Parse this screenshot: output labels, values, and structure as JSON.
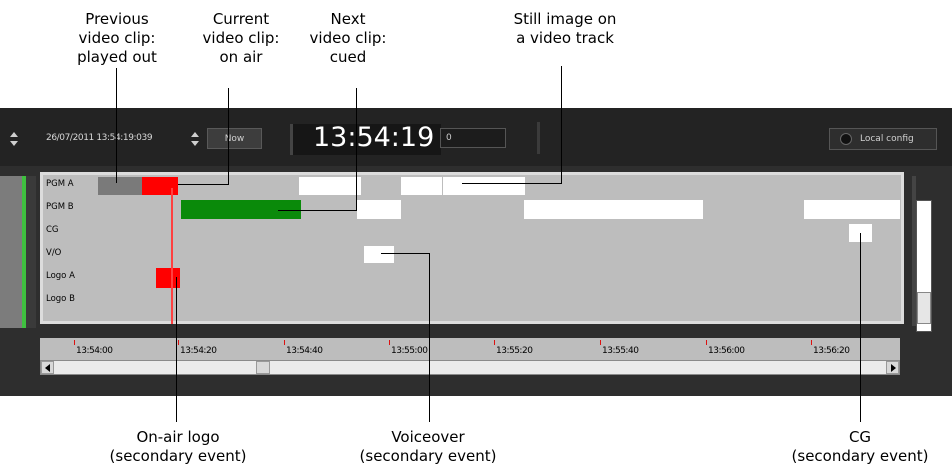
{
  "callouts": {
    "previous_clip": [
      "Previous",
      "video clip:",
      "played out"
    ],
    "current_clip": [
      "Current",
      "video clip:",
      "on air"
    ],
    "next_clip": [
      "Next",
      "video clip:",
      "cued"
    ],
    "still_image": [
      "Still image on",
      "a video track"
    ],
    "onair_logo": [
      "On-air logo",
      "(secondary event)"
    ],
    "voiceover": [
      "Voiceover",
      "(secondary event)"
    ],
    "cg": [
      "CG",
      "(secondary event)"
    ]
  },
  "toolbar": {
    "date_time": "26/07/2011 13:54:19:039",
    "now_label": "Now",
    "clock": "13:54:19",
    "frame_value": "0",
    "local_config_label": "Local config"
  },
  "tracks": [
    "PGM A",
    "PGM B",
    "CG",
    "V/O",
    "Logo A",
    "Logo B"
  ],
  "ruler": {
    "ticks": [
      "13:54:00",
      "13:54:20",
      "13:54:40",
      "13:55:00",
      "13:55:20",
      "13:55:40",
      "13:56:00",
      "13:56:20"
    ]
  },
  "colors": {
    "played_out": "#7a7a7a",
    "on_air": "#ff0000",
    "cued": "#0a8a0a",
    "still": "#ffffff",
    "playhead": "#ff4040"
  }
}
